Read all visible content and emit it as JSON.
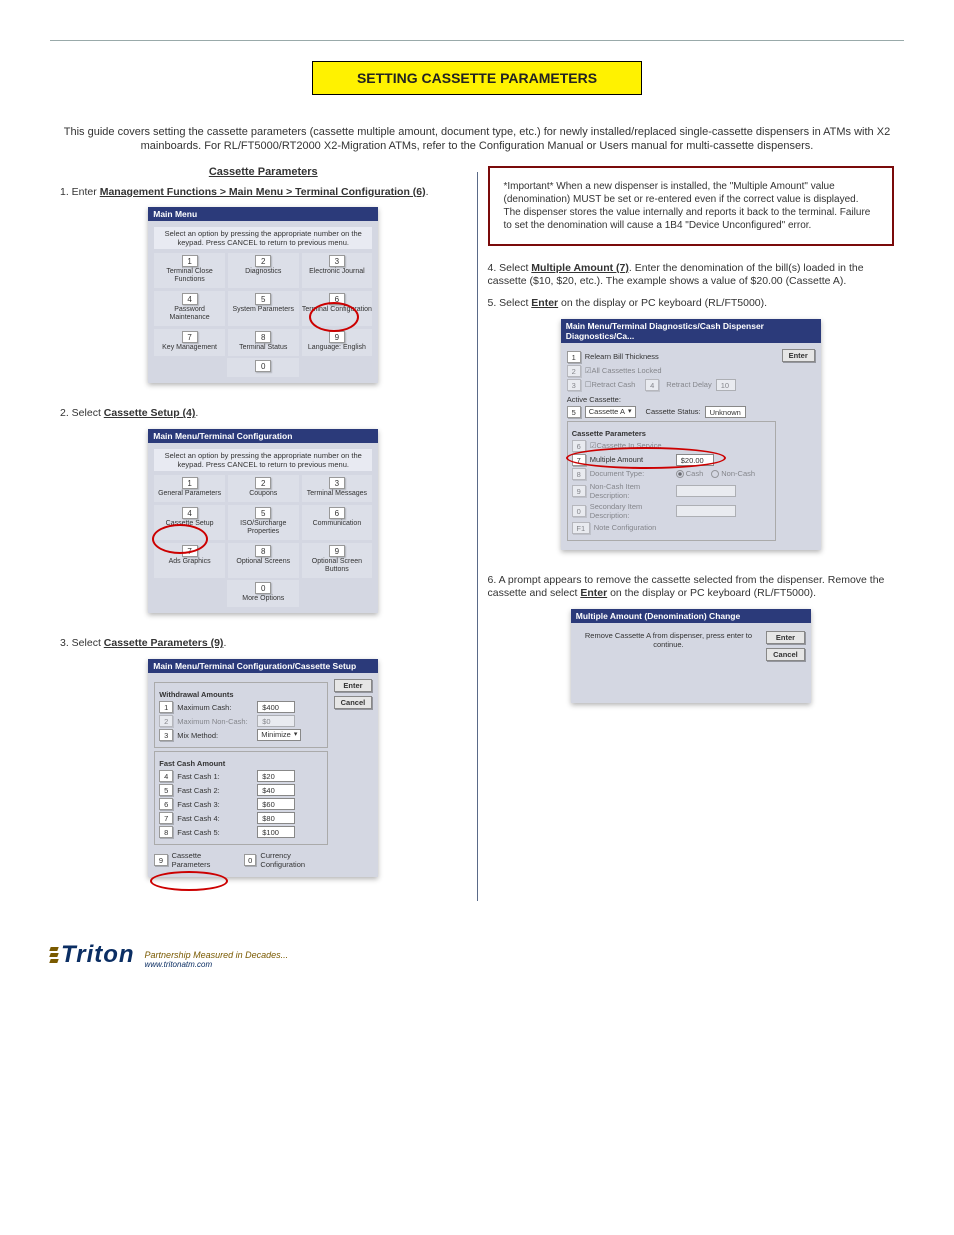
{
  "page_title": "Setting Cassette Parameters",
  "intro": "This guide covers setting the cassette parameters (cassette multiple amount, document type, etc.) for newly installed/replaced single-cassette dispensers in ATMs with X2 mainboards. For RL/FT5000/RT2000 X2-Migration ATMs, refer to the Configuration Manual or Users manual for multi-cassette dispensers.",
  "left": {
    "heading": "Cassette Parameters",
    "s1": "1. Enter Management Functions > Main Menu > Terminal Configuration (6).",
    "s2": "2. Select Cassette Setup (4).",
    "s3": "3. Select Cassette Parameters (9)."
  },
  "right": {
    "important": "*Important* When a new dispenser is installed, the \"Multiple Amount\" value (denomination) MUST be set or re-entered even if the correct value is displayed. The dispenser stores the value internally and reports it back to the terminal. Failure to set the denomination will cause a 1B4 \"Device Unconfigured\" error.",
    "s4": "4. Select Multiple Amount (7). Enter the denomination of the bill(s) loaded in the cassette ($10, $20, etc.). The example shows a value of $20.00 (Cassette A).",
    "s5": "5. Select Enter on the display or PC keyboard (RL/FT5000).",
    "s6": "6. A prompt appears to remove the cassette selected from the dispenser. Remove the cassette and select Enter on the display or PC keyboard (RL/FT5000)."
  },
  "ss_mainmenu": {
    "title": "Main Menu",
    "note": "Select an option by pressing the appropriate number on the keypad. Press CANCEL to return to previous menu.",
    "items": [
      {
        "n": "1",
        "label": "Terminal Close Functions"
      },
      {
        "n": "2",
        "label": "Diagnostics"
      },
      {
        "n": "3",
        "label": "Electronic Journal"
      },
      {
        "n": "4",
        "label": "Password Maintenance"
      },
      {
        "n": "5",
        "label": "System Parameters"
      },
      {
        "n": "6",
        "label": "Terminal Configuration"
      },
      {
        "n": "7",
        "label": "Key Management"
      },
      {
        "n": "8",
        "label": "Terminal Status"
      },
      {
        "n": "9",
        "label": "Language: English"
      }
    ],
    "zero": "0",
    "zero_label": ""
  },
  "ss_termconfig": {
    "title": "Main Menu/Terminal Configuration",
    "note": "Select an option by pressing the appropriate number on the keypad. Press CANCEL to return to previous menu.",
    "items": [
      {
        "n": "1",
        "label": "General Parameters"
      },
      {
        "n": "2",
        "label": "Coupons"
      },
      {
        "n": "3",
        "label": "Terminal Messages"
      },
      {
        "n": "4",
        "label": "Cassette Setup"
      },
      {
        "n": "5",
        "label": "ISO/Surcharge Properties"
      },
      {
        "n": "6",
        "label": "Communication"
      },
      {
        "n": "7",
        "label": "Ads Graphics"
      },
      {
        "n": "8",
        "label": "Optional Screens"
      },
      {
        "n": "9",
        "label": "Optional Screen Buttons"
      }
    ],
    "zero": "0",
    "zero_label": "More Options"
  },
  "ss_cassette_setup": {
    "title": "Main Menu/Terminal Configuration/Cassette Setup",
    "enter": "Enter",
    "cancel": "Cancel",
    "withdrawal_title": "Withdrawal Amounts",
    "rows": [
      {
        "n": "1",
        "label": "Maximum Cash:",
        "value": "$400"
      },
      {
        "n": "2",
        "label": "Maximum Non-Cash:",
        "value": "$0"
      },
      {
        "n": "3",
        "label": "Mix Method:",
        "value": "Minimize"
      }
    ],
    "fastcash_title": "Fast Cash Amount",
    "fastcash": [
      {
        "n": "4",
        "label": "Fast Cash 1:",
        "value": "$20"
      },
      {
        "n": "5",
        "label": "Fast Cash 2:",
        "value": "$40"
      },
      {
        "n": "6",
        "label": "Fast Cash 3:",
        "value": "$60"
      },
      {
        "n": "7",
        "label": "Fast Cash 4:",
        "value": "$80"
      },
      {
        "n": "8",
        "label": "Fast Cash 5:",
        "value": "$100"
      }
    ],
    "cassette_params_btn": {
      "n": "9",
      "label": "Cassette Parameters"
    },
    "currency_btn": {
      "n": "0",
      "label": "Currency Configuration"
    }
  },
  "ss_params": {
    "title": "Main Menu/Terminal Diagnostics/Cash Dispenser Diagnostics/Ca...",
    "enter": "Enter",
    "relearn": {
      "n": "1",
      "label": "Relearn Bill Thickness"
    },
    "all_locked": {
      "n": "2",
      "label": "All Cassettes Locked"
    },
    "retract": {
      "n": "3",
      "label": "Retract Cash"
    },
    "retract_delay": {
      "n": "4",
      "label": "Retract Delay",
      "value": "10"
    },
    "active_label": "Active Cassette:",
    "active": {
      "n": "5",
      "value": "Cassette A"
    },
    "status_label": "Cassette Status:",
    "status_value": "Unknown",
    "group_title": "Cassette Parameters",
    "in_service": {
      "n": "6",
      "label": "Cassette In Service"
    },
    "multiple": {
      "n": "7",
      "label": "Multiple Amount",
      "value": "$20.00"
    },
    "doc_type": {
      "n": "8",
      "label": "Document Type:",
      "cash": "Cash",
      "noncash": "Non-Cash"
    },
    "noncash_desc": {
      "n": "9",
      "label": "Non-Cash Item Description:"
    },
    "sec_desc": {
      "n": "0",
      "label": "Secondary Item Description:"
    },
    "note_cfg": {
      "n": "F1",
      "label": "Note Configuration"
    }
  },
  "ss_prompt": {
    "title": "Multiple Amount (Denomination) Change",
    "msg": "Remove Cassette A from dispenser, press enter to continue.",
    "enter": "Enter",
    "cancel": "Cancel"
  },
  "footer": {
    "brand": "Triton",
    "tagline": "Partnership Measured in Decades...",
    "site": "www.tritonatm.com"
  }
}
